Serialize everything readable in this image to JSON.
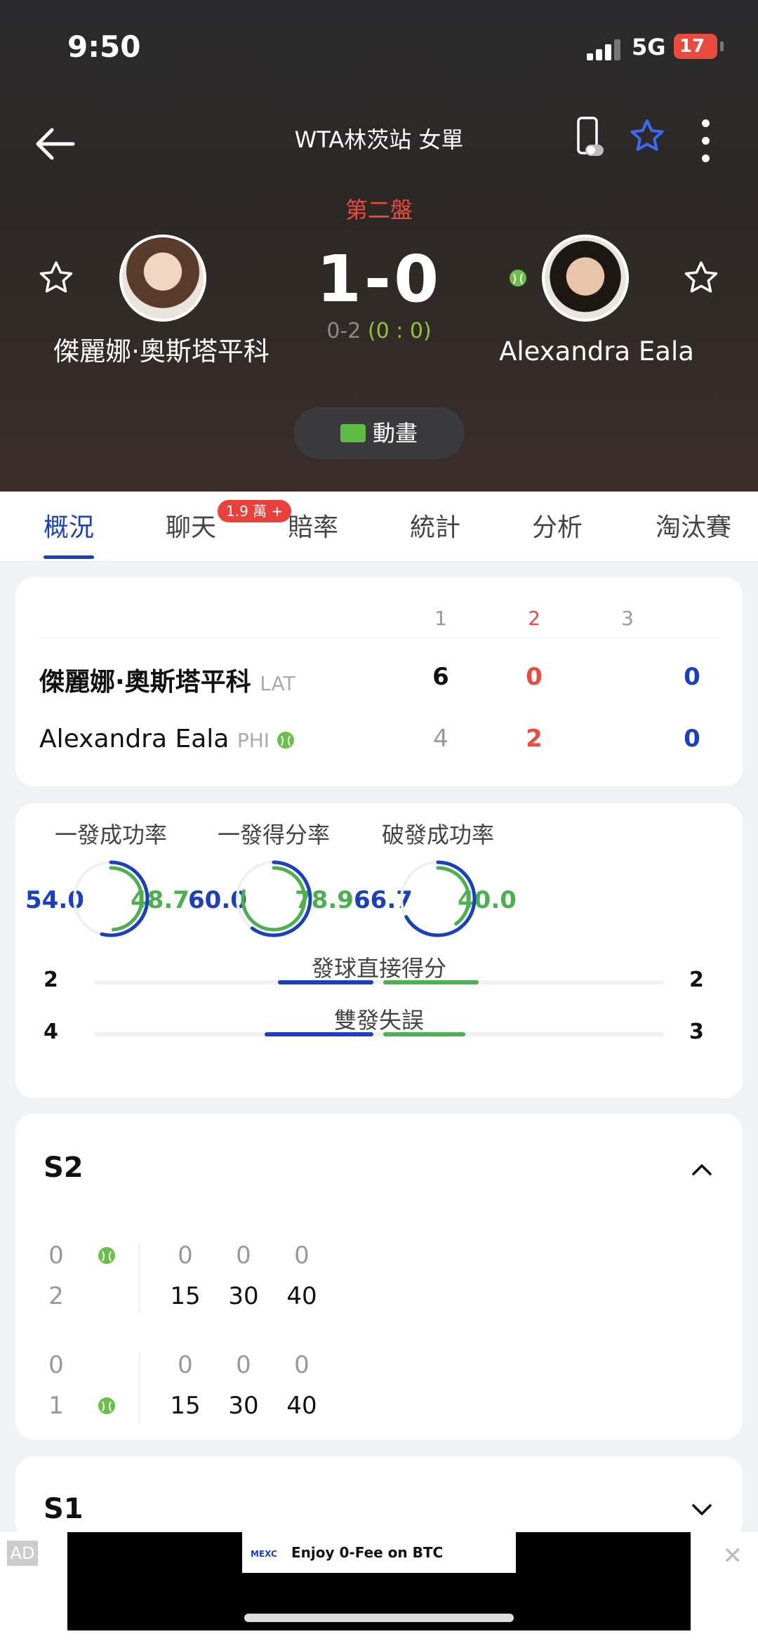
{
  "status_bar": {
    "time": "9:50",
    "network": "5G",
    "battery": "17"
  },
  "header": {
    "title": "WTA林茨站 女單"
  },
  "match": {
    "set_label": "第二盤",
    "score": "1-0",
    "game_score": "0-2",
    "point_score": "(0 : 0)",
    "player1": {
      "name": "傑麗娜·奧斯塔平科",
      "country": "LAT"
    },
    "player2": {
      "name": "Alexandra Eala",
      "country": "PHI"
    },
    "animation_label": "動畫"
  },
  "tabs": [
    "概況",
    "聊天",
    "賠率",
    "統計",
    "分析",
    "淘汰賽"
  ],
  "chat_badge": "1.9 萬 +",
  "scoreboard": {
    "set_headers": [
      "1",
      "2",
      "3"
    ],
    "rows": [
      {
        "name": "傑麗娜·奧斯塔平科",
        "country": "LAT",
        "sets": [
          "6",
          "0",
          "0"
        ]
      },
      {
        "name": "Alexandra Eala",
        "country": "PHI",
        "sets": [
          "4",
          "2",
          "0"
        ]
      }
    ]
  },
  "stats": {
    "rings": [
      {
        "label": "一發成功率",
        "left": "54.0",
        "right": "48.7",
        "left_frac": 0.54,
        "right_frac": 0.487
      },
      {
        "label": "一發得分率",
        "left": "60.0",
        "right": "78.9",
        "left_frac": 0.6,
        "right_frac": 0.789
      },
      {
        "label": "破發成功率",
        "left": "66.7",
        "right": "40.0",
        "left_frac": 0.667,
        "right_frac": 0.4
      }
    ],
    "bars": [
      {
        "label": "發球直接得分",
        "left": "2",
        "right": "2",
        "left_frac": 0.5,
        "right_frac": 0.5
      },
      {
        "label": "雙發失誤",
        "left": "4",
        "right": "3",
        "left_frac": 0.57,
        "right_frac": 0.43
      }
    ]
  },
  "s2": {
    "title": "S2",
    "games": [
      {
        "top": "0",
        "bottom": "2",
        "top_points": [
          "0",
          "0",
          "0"
        ],
        "bottom_points": [
          "15",
          "30",
          "40"
        ]
      },
      {
        "top": "0",
        "bottom": "1",
        "top_points": [
          "0",
          "0",
          "0"
        ],
        "bottom_points": [
          "15",
          "30",
          "40"
        ]
      }
    ]
  },
  "s1": {
    "title": "S1"
  },
  "ad": {
    "tag": "AD",
    "brand": "MEXC",
    "text": "Enjoy 0-Fee on BTC"
  },
  "colors": {
    "blue": "#1a3fbf",
    "green": "#4caf50",
    "red": "#e74c3c"
  }
}
